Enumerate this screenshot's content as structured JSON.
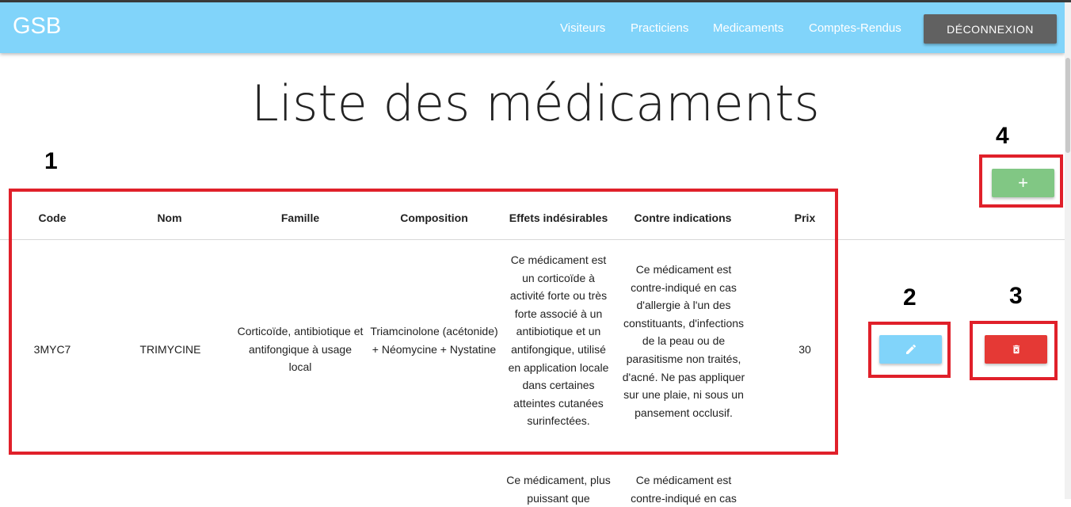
{
  "header": {
    "brand": "GSB",
    "nav": [
      "Visiteurs",
      "Practiciens",
      "Medicaments",
      "Comptes-Rendus"
    ],
    "logout_label": "DÉCONNEXION",
    "color": "#81d4fa"
  },
  "main": {
    "title": "Liste des médicaments",
    "add_label": "+",
    "columns": [
      "Code",
      "Nom",
      "Famille",
      "Composition",
      "Effets indésirables",
      "Contre indications",
      "Prix"
    ],
    "rows": [
      {
        "code": "3MYC7",
        "nom": "TRIMYCINE",
        "famille": "Corticoïde, antibiotique et antifongique à usage local",
        "composition": "Triamcinolone (acétonide) + Néomycine + Nystatine",
        "effets": "Ce médicament est un corticoïde à activité forte ou très forte associé à un antibiotique et un antifongique, utilisé en application locale dans certaines atteintes cutanées surinfectées.",
        "contre": "Ce médicament est contre-indiqué en cas d'allergie à l'un des constituants, d'infections de la peau ou de parasitisme non traités, d'acné. Ne pas appliquer sur une plaie, ni sous un pansement occlusif.",
        "prix": "30"
      },
      {
        "effets": "Ce médicament, plus puissant que",
        "contre": "Ce médicament est contre-indiqué en cas"
      }
    ]
  },
  "annotations": [
    "1",
    "2",
    "3",
    "4"
  ],
  "icons": {
    "edit": "pencil-icon",
    "delete": "trash-icon"
  }
}
